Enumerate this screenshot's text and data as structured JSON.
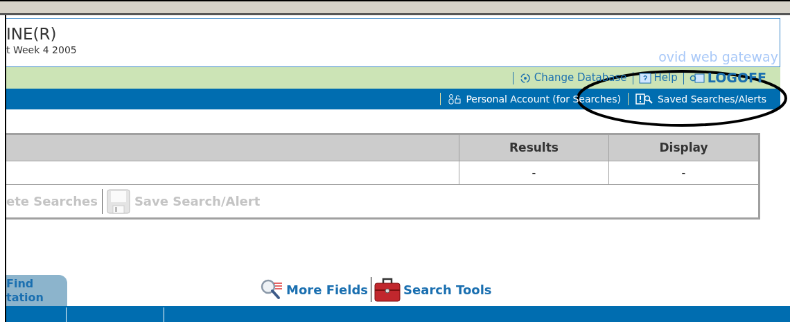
{
  "header": {
    "title": "INE(R)",
    "subtitle": "t Week 4 2005",
    "brand": "ovid web gateway"
  },
  "green_bar": [
    {
      "label": "Change Database",
      "kind": "database"
    },
    {
      "label": "Help",
      "kind": "help"
    },
    {
      "label": "LOGOFF",
      "kind": "logoff"
    }
  ],
  "blue_bar": [
    {
      "label": "Personal Account (for Searches)",
      "kind": "account"
    },
    {
      "label": "Saved Searches/Alerts",
      "kind": "saved"
    }
  ],
  "history_table": {
    "columns": [
      "Results",
      "Display"
    ],
    "rows": [
      [
        "-",
        "-"
      ]
    ],
    "actions": [
      {
        "label": "ete Searches",
        "kind": "delete",
        "disabled": true
      },
      {
        "label": "Save Search/Alert",
        "kind": "save",
        "disabled": true
      }
    ]
  },
  "search_tabs": [
    {
      "label": "Find\ntation",
      "selected": false
    }
  ],
  "search_links": [
    {
      "label": "More Fields",
      "kind": "fields"
    },
    {
      "label": "Search Tools",
      "kind": "tools"
    }
  ]
}
